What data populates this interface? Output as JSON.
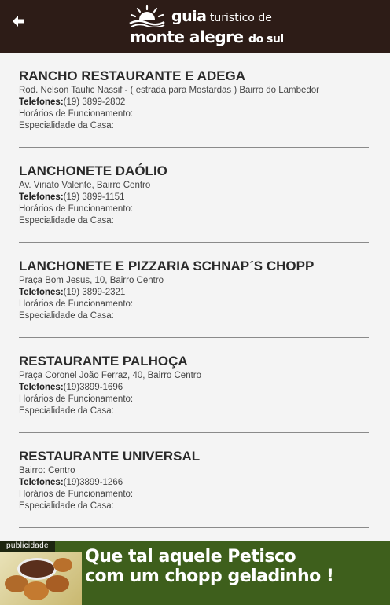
{
  "header": {
    "logo_line1_a": "guia",
    "logo_line1_b": "turistico",
    "logo_line1_c": "de",
    "logo_line2_a": "monte alegre",
    "logo_line2_b": "do sul"
  },
  "items": [
    {
      "name": "RANCHO RESTAURANTE E ADEGA",
      "address": "Rod. Nelson Taufic Nassif - ( estrada para Mostardas ) Bairro do Lambedor",
      "phone_label": "Telefones:",
      "phone": "(19) 3899-2802",
      "hours_label": "Horários de Funcionamento:",
      "specialty_label": "Especialidade da Casa:"
    },
    {
      "name": "LANCHONETE DAÓLIO",
      "address": "Av. Viriato Valente, Bairro Centro",
      "phone_label": "Telefones:",
      "phone": "(19) 3899-1151",
      "hours_label": "Horários de Funcionamento:",
      "specialty_label": "Especialidade da Casa:"
    },
    {
      "name": "LANCHONETE E PIZZARIA SCHNAP´S CHOPP",
      "address": "Praça Bom Jesus, 10, Bairro Centro",
      "phone_label": "Telefones:",
      "phone": "(19) 3899-2321",
      "hours_label": "Horários de Funcionamento:",
      "specialty_label": "Especialidade da Casa:"
    },
    {
      "name": "RESTAURANTE PALHOÇA",
      "address": "Praça Coronel João Ferraz, 40, Bairro Centro",
      "phone_label": "Telefones:",
      "phone": "(19)3899-1696",
      "hours_label": "Horários de Funcionamento:",
      "specialty_label": "Especialidade da Casa:"
    },
    {
      "name": "RESTAURANTE UNIVERSAL",
      "address": "Bairro: Centro",
      "phone_label": "Telefones:",
      "phone": "(19)3899-1266",
      "hours_label": "Horários de Funcionamento:",
      "specialty_label": "Especialidade da Casa:"
    }
  ],
  "ad": {
    "tag": "publicidade",
    "line1": "Que tal aquele Petisco",
    "line2": "com um chopp geladinho !"
  }
}
